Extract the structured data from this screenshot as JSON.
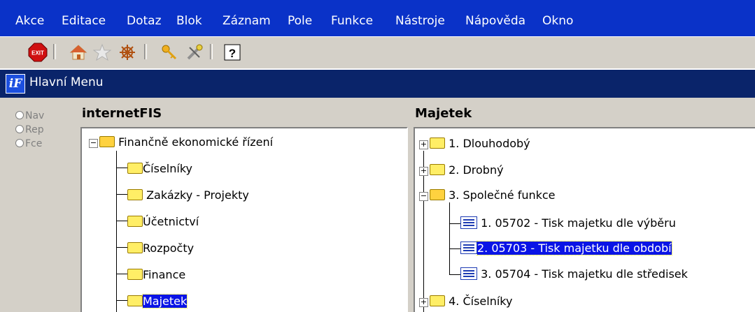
{
  "menubar": {
    "items": [
      "Akce",
      "Editace",
      "Dotaz",
      "Blok",
      "Záznam",
      "Pole",
      "Funkce",
      "Nástroje",
      "Nápověda",
      "Okno"
    ]
  },
  "toolbar": {
    "icons": [
      "exit-icon",
      "home-icon",
      "star-icon",
      "ship-wheel-icon",
      "key-icon",
      "tools-icon",
      "help-icon"
    ],
    "exit_label": "EXIT",
    "help_label": "?"
  },
  "window": {
    "title": "Hlavní Menu",
    "icon_label": "iF"
  },
  "modes": [
    "Nav",
    "Rep",
    "Fce"
  ],
  "left_panel": {
    "title": "internetFIS",
    "root": "Finančně ekonomické řízení",
    "items": [
      "Číselníky",
      "Zakázky - Projekty",
      "Účetnictví",
      "Rozpočty",
      "Finance",
      "Majetek"
    ]
  },
  "right_panel": {
    "title": "Majetek",
    "items": [
      "1. Dlouhodobý",
      "2. Drobný",
      "3. Společné funkce",
      "4. Číselníky"
    ],
    "subitems": [
      "1. 05702 - Tisk majetku dle výběru",
      "2. 05703 - Tisk majetku dle období",
      "3. 05704 - Tisk  majetku dle středisek"
    ]
  }
}
